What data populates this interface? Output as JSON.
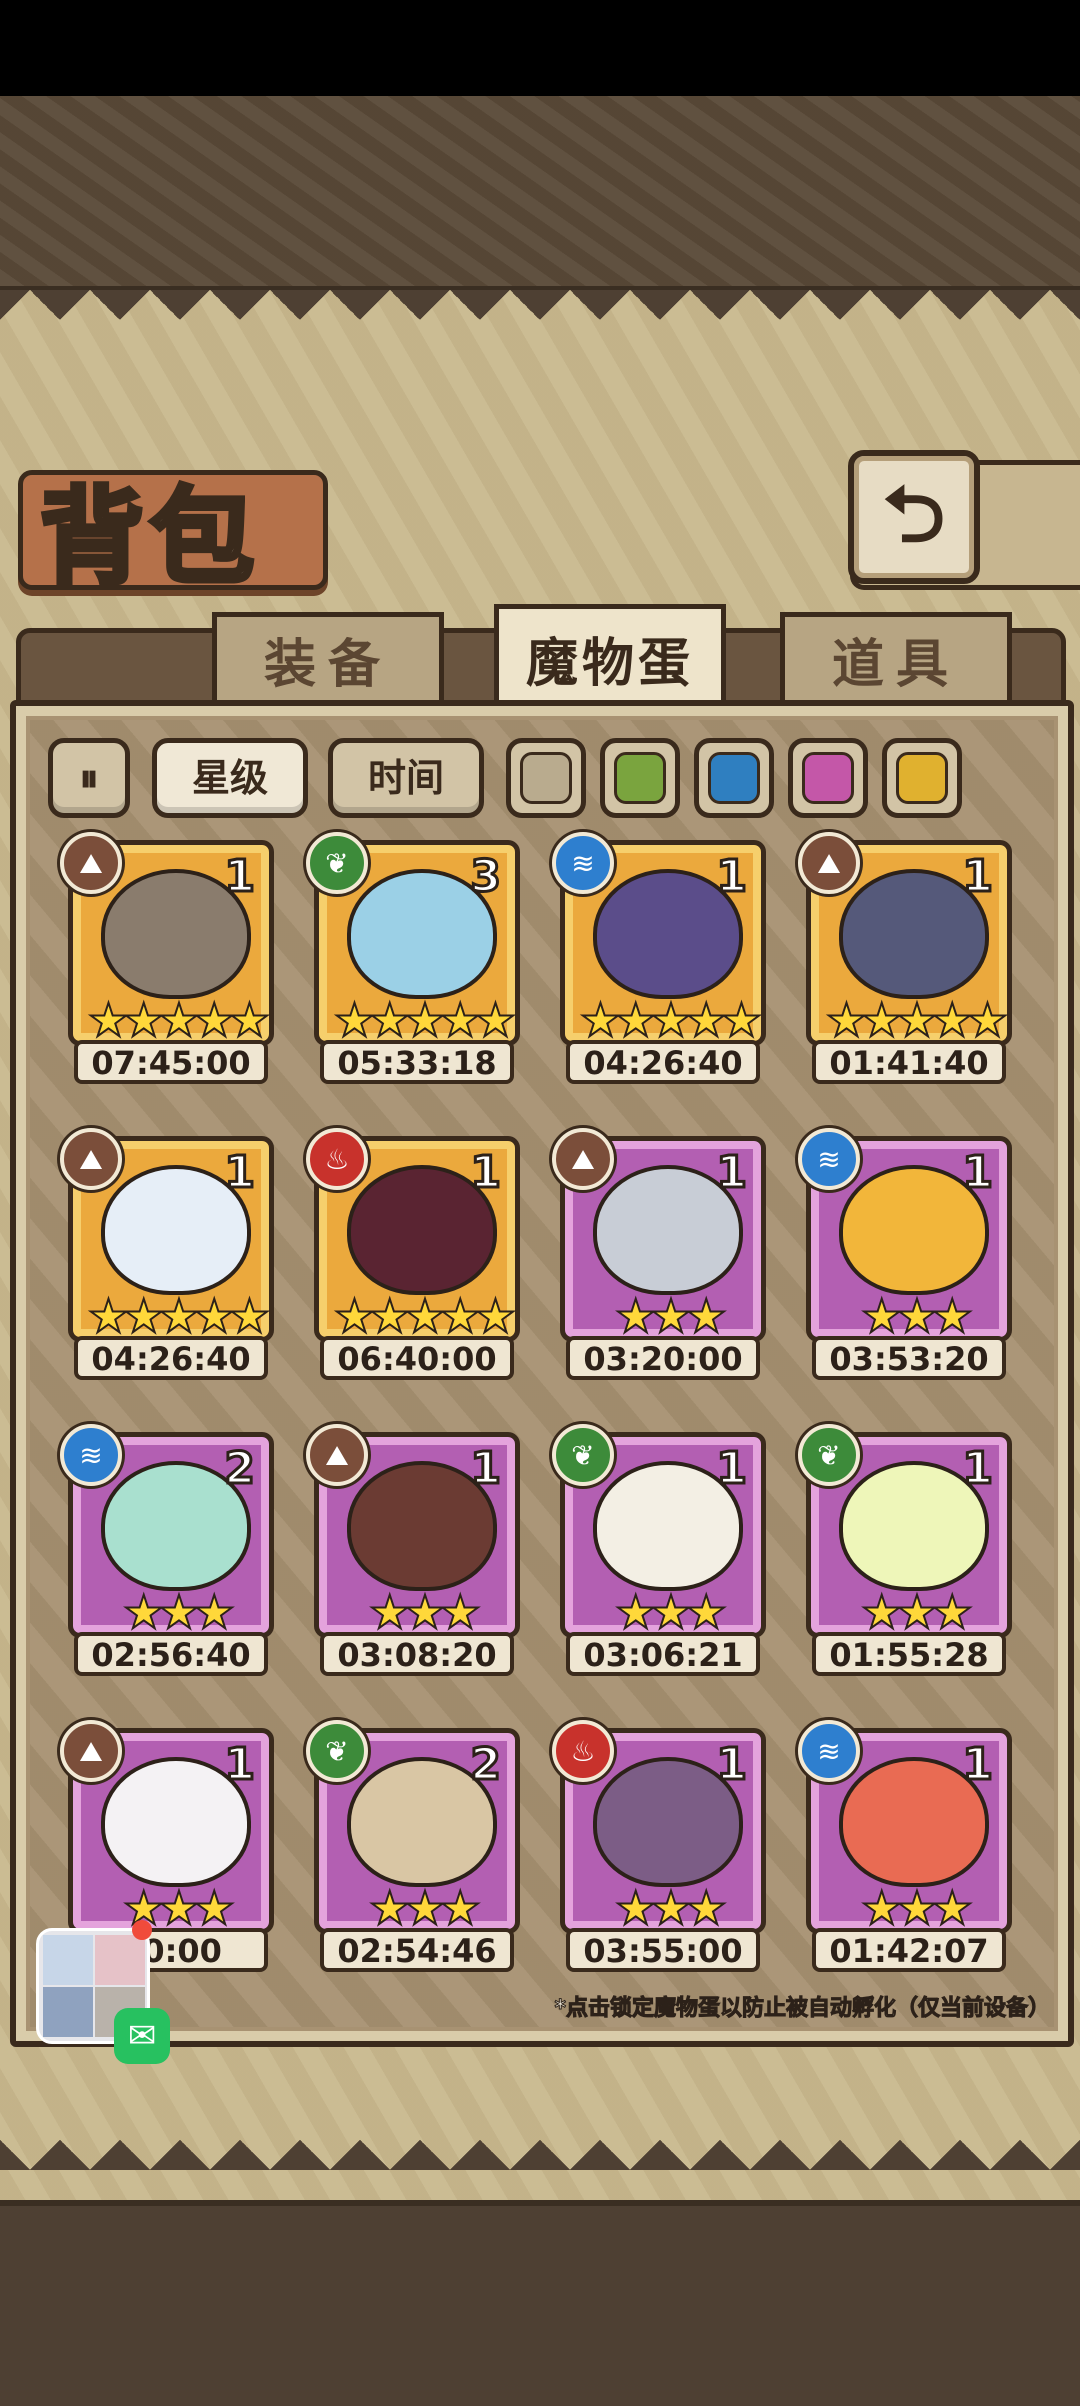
{
  "header": {
    "title": "背包",
    "back_icon": "⮌"
  },
  "tabs": [
    {
      "label": "装备",
      "active": false
    },
    {
      "label": "魔物蛋",
      "active": true
    },
    {
      "label": "道具",
      "active": false
    }
  ],
  "filters": {
    "collapse_icon": "⏸",
    "sort_options": [
      {
        "label": "星级",
        "active": true
      },
      {
        "label": "时间",
        "active": false
      }
    ],
    "rarity_colors": [
      "#b9ab8e",
      "#7aa43e",
      "#2f7fc0",
      "#c457a8",
      "#e0b12f"
    ]
  },
  "element_glyphs": {
    "earth": "⛰",
    "grass": "❦",
    "water": "≋",
    "fire": "♨"
  },
  "eggs": [
    {
      "time": "07:45:00",
      "count": "1",
      "stars": "★★★★★",
      "frame": "gold",
      "element": "earth",
      "color": "#8a7c6d"
    },
    {
      "time": "05:33:18",
      "count": "3",
      "stars": "★★★★★",
      "frame": "gold",
      "element": "grass",
      "color": "#9bd0e6"
    },
    {
      "time": "04:26:40",
      "count": "1",
      "stars": "★★★★★",
      "frame": "gold",
      "element": "water",
      "color": "#5b4d8a"
    },
    {
      "time": "01:41:40",
      "count": "1",
      "stars": "★★★★★",
      "frame": "gold",
      "element": "earth",
      "color": "#55597a"
    },
    {
      "time": "04:26:40",
      "count": "1",
      "stars": "★★★★★",
      "frame": "gold",
      "element": "earth",
      "color": "#e6eef7"
    },
    {
      "time": "06:40:00",
      "count": "1",
      "stars": "★★★★★",
      "frame": "gold",
      "element": "fire",
      "color": "#5a2432"
    },
    {
      "time": "03:20:00",
      "count": "1",
      "stars": "★★★",
      "frame": "purple",
      "element": "earth",
      "color": "#c8cdd6"
    },
    {
      "time": "03:53:20",
      "count": "1",
      "stars": "★★★",
      "frame": "purple",
      "element": "water",
      "color": "#f2b63a"
    },
    {
      "time": "02:56:40",
      "count": "2",
      "stars": "★★★",
      "frame": "purple",
      "element": "water",
      "color": "#a9e0cf"
    },
    {
      "time": "03:08:20",
      "count": "1",
      "stars": "★★★",
      "frame": "purple",
      "element": "earth",
      "color": "#6b3b33"
    },
    {
      "time": "03:06:21",
      "count": "1",
      "stars": "★★★",
      "frame": "purple",
      "element": "grass",
      "color": "#f3efe4"
    },
    {
      "time": "01:55:28",
      "count": "1",
      "stars": "★★★",
      "frame": "purple",
      "element": "grass",
      "color": "#eef6b9"
    },
    {
      "time": "50:00",
      "count": "1",
      "stars": "★★★",
      "frame": "purple",
      "element": "earth",
      "color": "#f4f2f4"
    },
    {
      "time": "02:54:46",
      "count": "2",
      "stars": "★★★",
      "frame": "purple",
      "element": "grass",
      "color": "#d9c6a4"
    },
    {
      "time": "03:55:00",
      "count": "1",
      "stars": "★★★",
      "frame": "purple",
      "element": "fire",
      "color": "#7c5d86"
    },
    {
      "time": "01:42:07",
      "count": "1",
      "stars": "★★★",
      "frame": "purple",
      "element": "water",
      "color": "#e96b53"
    }
  ],
  "hint": "*点击锁定魔物蛋以防止被自动孵化（仅当前设备）",
  "overlay": {
    "wechat_icon": "✉"
  }
}
